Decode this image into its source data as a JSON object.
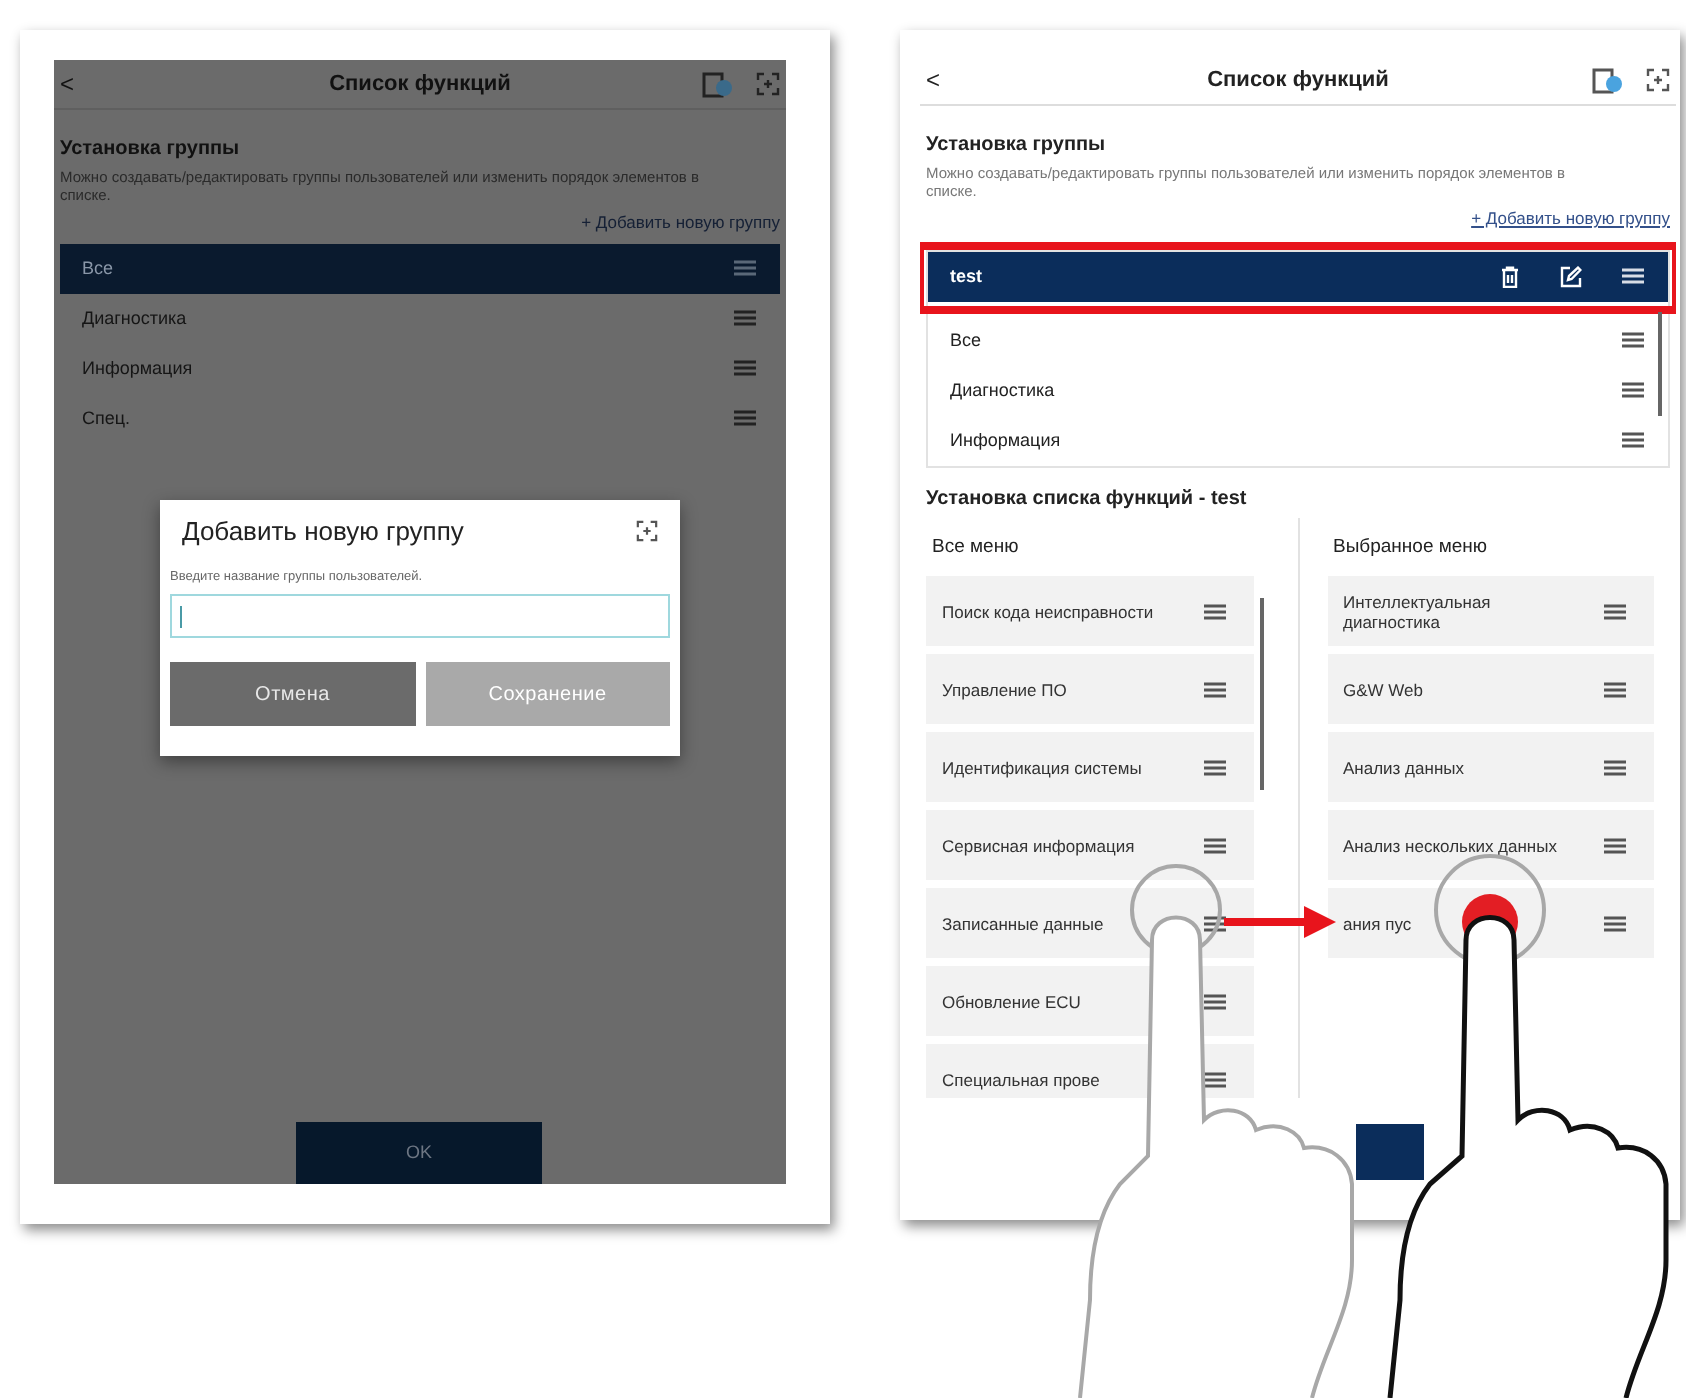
{
  "left_screen": {
    "header": {
      "back": "<",
      "title": "Список функций"
    },
    "group_section": {
      "title": "Установка группы",
      "description": "Можно создавать/редактировать группы пользователей или изменить порядок элементов в списке.",
      "add_link": "+ Добавить новую группу"
    },
    "groups": [
      {
        "label": "Все",
        "selected": true
      },
      {
        "label": "Диагностика",
        "selected": false
      },
      {
        "label": "Информация",
        "selected": false
      },
      {
        "label": "Спец.",
        "selected": false
      }
    ],
    "dialog": {
      "title": "Добавить новую группу",
      "hint": "Введите название группы пользователей.",
      "buttons": [
        {
          "label": "Отмена",
          "disabled": false
        },
        {
          "label": "Сохранение",
          "disabled": true
        }
      ]
    },
    "ok_button": "OK"
  },
  "right_screen": {
    "header": {
      "back": "<",
      "title": "Список функций"
    },
    "group_section": {
      "title": "Установка группы",
      "description": "Можно создавать/редактировать группы пользователей или изменить порядок элементов в списке.",
      "add_link": "+ Добавить новую группу"
    },
    "groups": [
      {
        "label": "test",
        "selected": true
      },
      {
        "label": "Все",
        "selected": false
      },
      {
        "label": "Диагностика",
        "selected": false
      },
      {
        "label": "Информация",
        "selected": false
      }
    ],
    "function_section": {
      "title": "Установка списка функций - test",
      "all_menu": {
        "title": "Все меню",
        "items": [
          "Поиск кода неисправности",
          "Управление ПО",
          "Идентификация системы",
          "Сервисная информация",
          "Записанные данные",
          "Обновление ECU",
          "Специальная прове"
        ]
      },
      "selected_menu": {
        "title": "Выбранное меню",
        "items": [
          "Интеллектуальная диагностика",
          "G&W Web",
          "Анализ данных",
          "Анализ нескольких данных",
          "ания пус"
        ]
      }
    }
  }
}
